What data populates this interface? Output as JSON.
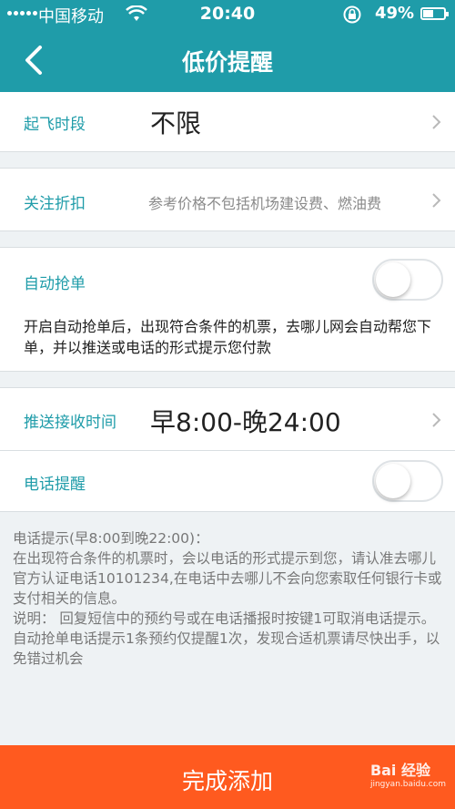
{
  "status_bar": {
    "carrier": "中国移动",
    "time": "20:40",
    "battery": "49%",
    "battery_level": 0.49
  },
  "nav": {
    "title": "低价提醒"
  },
  "departure_period": {
    "label": "起飞时段",
    "value": "不限"
  },
  "discount": {
    "label": "关注折扣",
    "value": "参考价格不包括机场建设费、燃油费"
  },
  "auto_grab": {
    "label": "自动抢单",
    "enabled": false,
    "description": "开启自动抢单后，出现符合条件的机票，去哪儿网会自动帮您下单，并以推送或电话的形式提示您付款"
  },
  "push_time": {
    "label": "推送接收时间",
    "value": "早8:00-晚24:00"
  },
  "phone_reminder": {
    "label": "电话提醒",
    "enabled": false
  },
  "info": {
    "lines": [
      "电话提示(早8:00到晚22:00)：",
      "在出现符合条件的机票时，会以电话的形式提示到您，请认准去哪儿官方认证电话10101234,在电话中去哪儿不会向您索取任何银行卡或支付相关的信息。",
      "说明： 回复短信中的预约号或在电话播报时按键1可取消电话提示。",
      "自动抢单电话提示1条预约仅提醒1次，发现合适机票请尽快出手，以免错过机会"
    ]
  },
  "submit": {
    "label": "完成添加"
  },
  "watermark": {
    "brand": "Bai 经验",
    "url": "jingyan.baidu.com"
  },
  "colors": {
    "accent": "#1f9ca9",
    "submit": "#ff5a1f"
  }
}
